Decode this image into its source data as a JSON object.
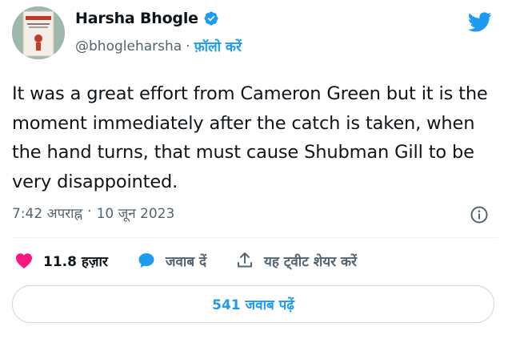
{
  "author": {
    "display_name": "Harsha Bhogle",
    "handle": "@bhogleharsha",
    "separator": "·",
    "follow_label": "फ़ॉलो करें"
  },
  "tweet": {
    "text": "It was a great effort from Cameron Green but it is the moment immediately after the catch is taken, when the hand turns, that must cause Shubman Gill to be very disappointed.",
    "time": "7:42 अपराह्न",
    "separator": "·",
    "date": "10 जून 2023"
  },
  "actions": {
    "likes_count": "11.8 हज़ार",
    "reply_label": "जवाब दें",
    "share_label": "यह ट्वीट शेयर करें"
  },
  "replies_button_label": "541 जवाब पढ़ें",
  "colors": {
    "accent": "#1d9bf0",
    "like": "#f91880",
    "muted_text": "#536471",
    "text": "#0f1419"
  },
  "icons": [
    "verified-badge-icon",
    "twitter-bird-icon",
    "info-icon",
    "heart-icon",
    "reply-bubble-icon",
    "share-icon"
  ]
}
